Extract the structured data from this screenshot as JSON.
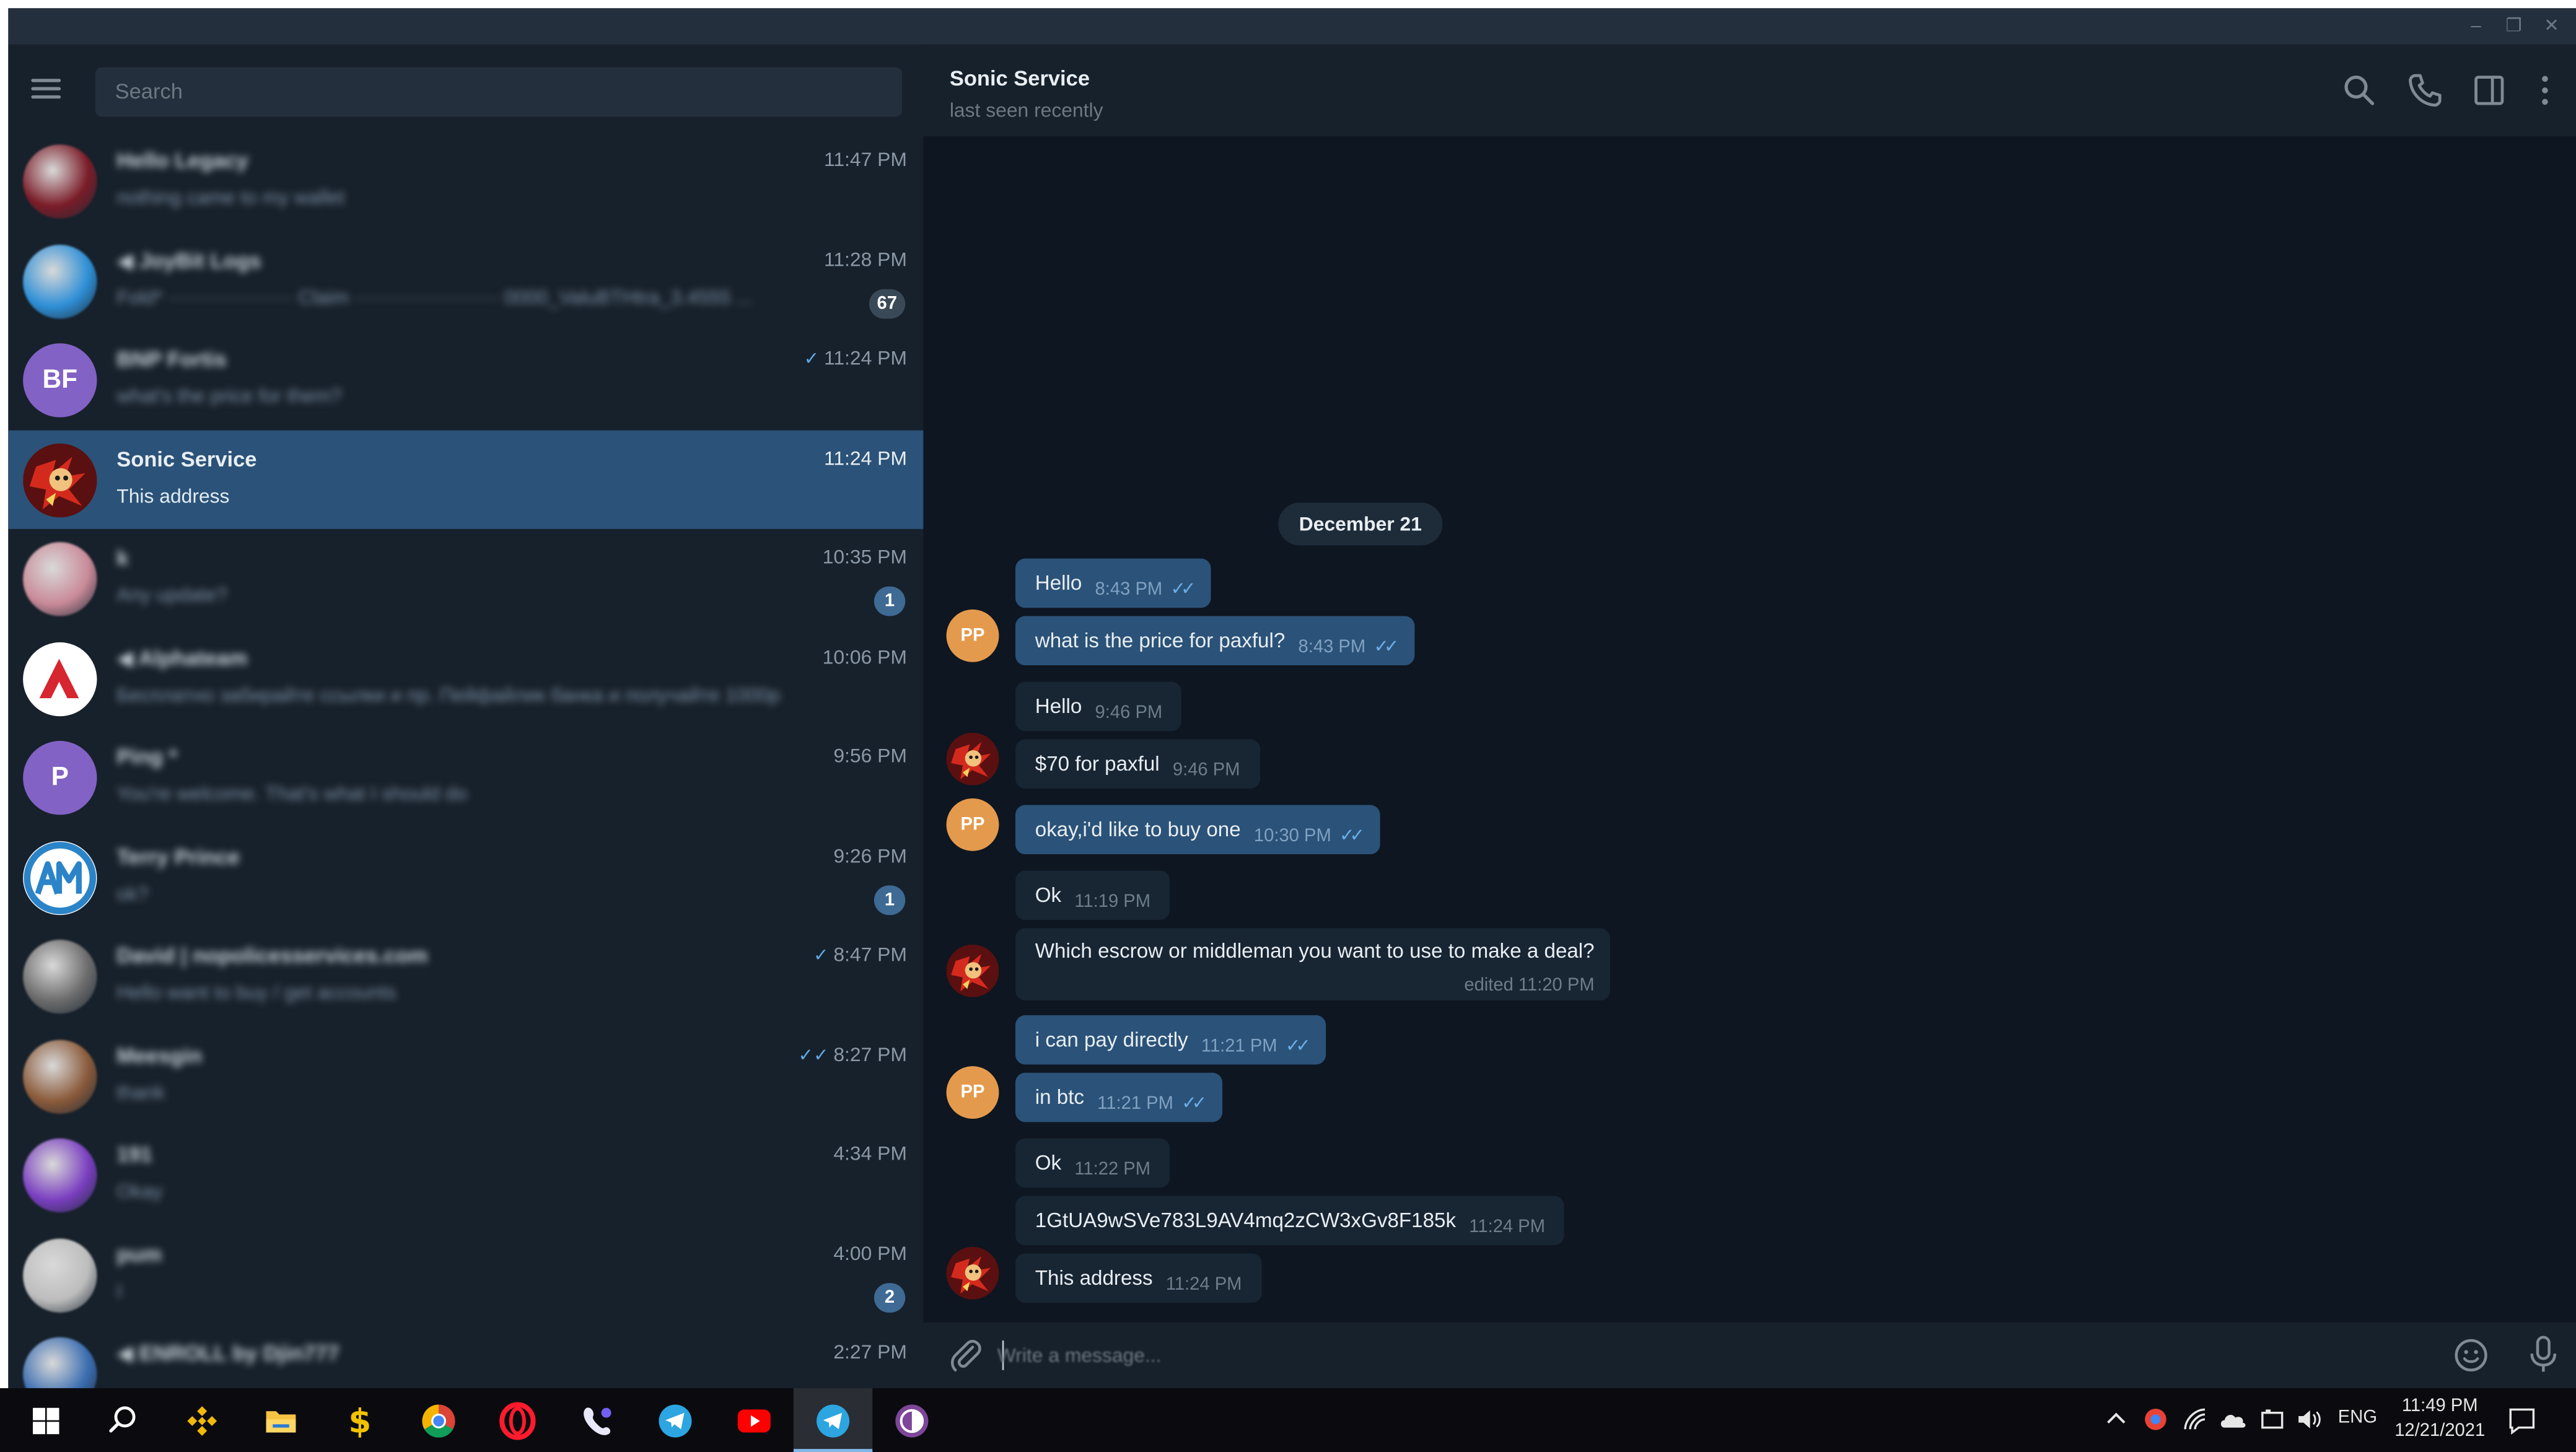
{
  "window": {
    "controls": {
      "minimize": "–",
      "restore": "❐",
      "close": "✕"
    }
  },
  "sidebar": {
    "search_placeholder": "Search",
    "chats": [
      {
        "name": "Hello Legacy",
        "preview": "nothing came to my wallet",
        "time": "11:47 PM",
        "blurred": true,
        "avatar_kind": "image",
        "avatar_color": "#7a1c28"
      },
      {
        "name": "◀ JoyBit Logs",
        "preview": "Fold* ··················· Claim ······················ 0000_ValuBTHtra_3.4555 ...",
        "time": "11:28 PM",
        "badge": "67",
        "badge_muted": true,
        "blurred": true,
        "avatar_kind": "image",
        "avatar_color": "#2e8fd6"
      },
      {
        "name": "BNP Fortis",
        "preview": "what's the price for them?",
        "time": "11:24 PM",
        "check": "✓",
        "blurred": true,
        "avatar_kind": "initials",
        "initials": "BF",
        "avatar_color": "#8262c4"
      },
      {
        "name": "Sonic Service",
        "preview": "This address",
        "time": "11:24 PM",
        "active": true,
        "blurred": false,
        "avatar_kind": "sonic",
        "avatar_color": "#b21b12"
      },
      {
        "name": "k",
        "preview": "Any update?",
        "time": "10:35 PM",
        "badge": "1",
        "blurred": true,
        "avatar_kind": "image",
        "avatar_color": "#c98a98"
      },
      {
        "name": "◀ Alphateam",
        "preview": "Бесплатно забирайте ссылки и пр. Пейфайлик банка и получайте 1000р",
        "time": "10:06 PM",
        "blurred": true,
        "avatar_kind": "alpha",
        "avatar_color": "#ffffff"
      },
      {
        "name": "Ping *",
        "preview": "You're welcome. That's what I should do",
        "time": "9:56 PM",
        "blurred": true,
        "avatar_kind": "initials",
        "initials": "P",
        "avatar_color": "#8262c4"
      },
      {
        "name": "Terry Prince",
        "preview": "ok?",
        "time": "9:26 PM",
        "badge": "1",
        "blurred": true,
        "avatar_kind": "atm",
        "avatar_color": "#2b84c8"
      },
      {
        "name": "David | nopolicesservices.com",
        "preview": "Hello want to buy / get accounts",
        "time": "8:47 PM",
        "check": "✓",
        "blurred": true,
        "avatar_kind": "image",
        "avatar_color": "#6b6b6b"
      },
      {
        "name": "Meesgin",
        "preview": "thank",
        "time": "8:27 PM",
        "check": "✓✓",
        "blurred": true,
        "avatar_kind": "image",
        "avatar_color": "#8a5a3a"
      },
      {
        "name": "191",
        "preview": "Okay",
        "time": "4:34 PM",
        "blurred": true,
        "avatar_kind": "image",
        "avatar_color": "#7a3fc0"
      },
      {
        "name": "pum",
        "preview": "I",
        "time": "4:00 PM",
        "badge": "2",
        "blurred": true,
        "avatar_kind": "image",
        "avatar_color": "#bdbdbd"
      },
      {
        "name": "◀ ENROLL by Djin777",
        "preview": "",
        "time": "2:27 PM",
        "blurred": true,
        "avatar_kind": "image",
        "avatar_color": "#3a6db0"
      }
    ]
  },
  "chat": {
    "title": "Sonic Service",
    "status": "last seen recently",
    "date_label": "December 21",
    "messages": [
      {
        "text": "Hello",
        "time": "8:43 PM",
        "out": true,
        "check": "✓✓"
      },
      {
        "text": "what is the price for paxful?",
        "time": "8:43 PM",
        "out": true,
        "check": "✓✓",
        "avatar": "PP"
      },
      {
        "text": "Hello",
        "time": "9:46 PM",
        "out": false
      },
      {
        "text": "$70 for paxful",
        "time": "9:46 PM",
        "out": false,
        "avatar": "sonic"
      },
      {
        "text": "okay,i'd like to buy one",
        "time": "10:30 PM",
        "out": true,
        "check": "✓✓",
        "avatar": "PP"
      },
      {
        "text": "Ok",
        "time": "11:19 PM",
        "out": false
      },
      {
        "text": "Which escrow or middleman you want to use to make a deal?",
        "time": "edited 11:20 PM",
        "out": false,
        "avatar": "sonic"
      },
      {
        "text": "i can pay directly",
        "time": "11:21 PM",
        "out": true,
        "check": "✓✓"
      },
      {
        "text": "in btc",
        "time": "11:21 PM",
        "out": true,
        "check": "✓✓",
        "avatar": "PP"
      },
      {
        "text": "Ok",
        "time": "11:22 PM",
        "out": false
      },
      {
        "text": "1GtUA9wSVe783L9AV4mq2zCW3xGv8F185k",
        "time": "11:24 PM",
        "out": false
      },
      {
        "text": "This address",
        "time": "11:24 PM",
        "out": false,
        "avatar": "sonic"
      }
    ],
    "composer_placeholder": "Write a message..."
  },
  "taskbar": {
    "language": "ENG",
    "time": "11:49 PM",
    "date": "12/21/2021"
  },
  "colors": {
    "sidebar_bg": "#17212b",
    "chat_bg": "#0e1621",
    "active_chat": "#2b5278",
    "outgoing_bubble": "#2b5278",
    "incoming_bubble": "#182533",
    "pp_avatar": "#e49a4c",
    "check_blue": "#6aaeea"
  }
}
